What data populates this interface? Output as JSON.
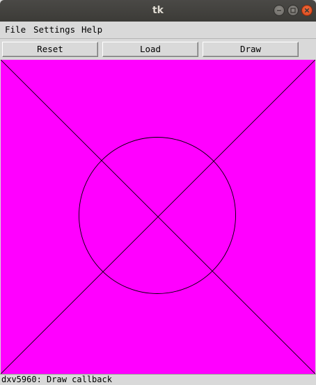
{
  "window": {
    "title": "tk"
  },
  "menubar": {
    "items": [
      {
        "label": "File"
      },
      {
        "label": "Settings"
      },
      {
        "label": "Help"
      }
    ]
  },
  "toolbar": {
    "reset_label": "Reset",
    "load_label": "Load",
    "draw_label": "Draw"
  },
  "canvas": {
    "background": "#ff00ff",
    "line_color": "#000000",
    "shapes": [
      "diagonal-line",
      "diagonal-line",
      "circle"
    ]
  },
  "status": {
    "text": "dxv5960: Draw callback"
  },
  "colors": {
    "window_bg": "#d9d9d9",
    "titlebar_bg": "#3c3b37",
    "close_button": "#e95420"
  }
}
